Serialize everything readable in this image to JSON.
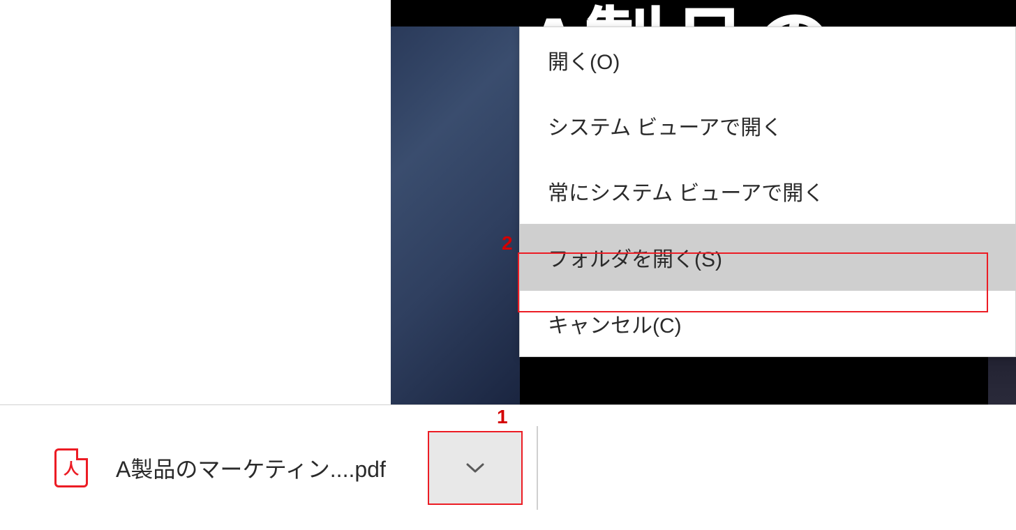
{
  "page_content": {
    "title_fragment": "A製品の"
  },
  "context_menu": {
    "items": [
      {
        "label": "開く(O)",
        "highlighted": false
      },
      {
        "label": "システム ビューアで開く",
        "highlighted": false
      },
      {
        "label": "常にシステム ビューアで開く",
        "highlighted": false
      }
    ],
    "divider_after_index": 2,
    "folder_item": {
      "label": "フォルダを開く(S)",
      "highlighted": true
    },
    "cancel_item": {
      "label": "キャンセル(C)",
      "highlighted": false
    }
  },
  "download_bar": {
    "filename": "A製品のマーケティン....pdf",
    "icon_label": "人"
  },
  "annotations": {
    "marker1": "1",
    "marker2": "2"
  }
}
